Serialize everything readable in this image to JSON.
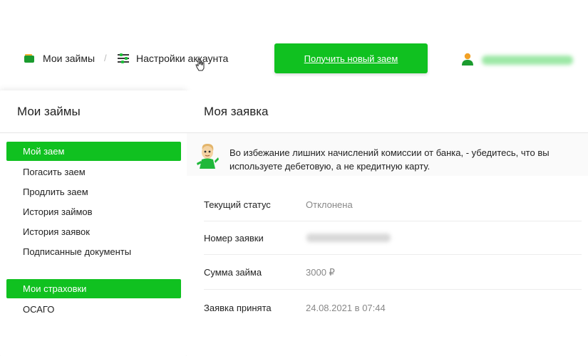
{
  "topnav": {
    "my_loans": "Мои займы",
    "separator": "/",
    "settings": "Настройки аккаунта",
    "new_loan_button": "Получить новый заем"
  },
  "sidebar": {
    "title": "Мои займы",
    "items": [
      {
        "label": "Мой заем",
        "active": true
      },
      {
        "label": "Погасить заем"
      },
      {
        "label": "Продлить заем"
      },
      {
        "label": "История займов"
      },
      {
        "label": "История заявок"
      },
      {
        "label": "Подписанные документы"
      }
    ],
    "section2": {
      "label": "Мои страховки",
      "active": true
    },
    "section2_items": [
      {
        "label": "ОСАГО"
      }
    ]
  },
  "main": {
    "title": "Моя заявка",
    "notice": "Во избежание лишних начислений комиссии от банка, - убедитесь, что вы используете дебетовую, а не кредитную карту.",
    "fields": [
      {
        "label": "Текущий статус",
        "value": "Отклонена"
      },
      {
        "label": "Номер заявки",
        "value": ""
      },
      {
        "label": "Сумма займа",
        "value": "3000 ₽"
      },
      {
        "label": "Заявка принята",
        "value": "24.08.2021 в 07:44"
      }
    ]
  },
  "colors": {
    "accent": "#10c120",
    "accent_dark": "#1a9b2e"
  }
}
